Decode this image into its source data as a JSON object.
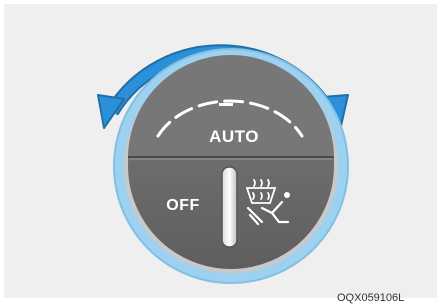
{
  "knob": {
    "auto_label": "AUTO",
    "off_label": "OFF",
    "defrost_icon": "windshield-defrost-icon",
    "rotate_icon": "rotate-arrow-icon"
  },
  "figure_code": "OQX059106L",
  "colors": {
    "arrow": "#2b90d9",
    "ring": "#9ed1f0",
    "knob_body": "#6d6d6d",
    "background": "#efefef"
  }
}
